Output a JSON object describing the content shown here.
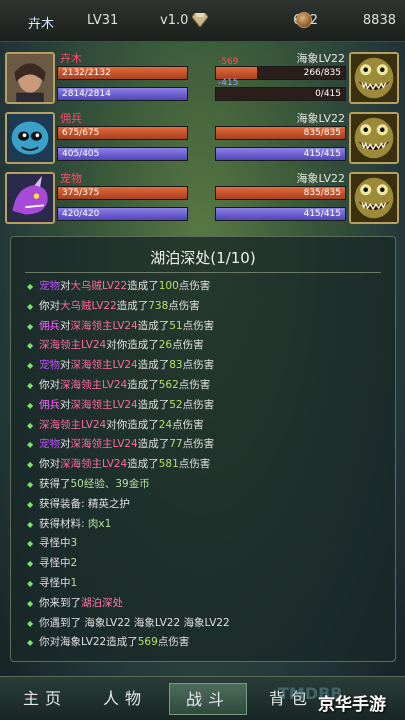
{
  "topbar": {
    "player_name": "卉木",
    "level": "LV31",
    "version": "v1.0",
    "gem_icon": "diamond-icon",
    "money": "622",
    "coin_icon": "coin-icon",
    "gold": "8838"
  },
  "party": [
    {
      "ally": {
        "name": "卉木",
        "hp_text": "2132/2132",
        "hp_frac": 1.0,
        "mp_text": "2814/2814",
        "mp_frac": 1.0,
        "portrait": "hero-portrait"
      },
      "enemy": {
        "name": "海象LV22",
        "hp_text": "266/835",
        "hp_frac": 0.32,
        "mp_text": "0/415",
        "mp_frac": 0.0,
        "dmg_hp": "-569",
        "dmg_mp": "-415",
        "portrait": "walrus-monster-portrait"
      }
    },
    {
      "ally": {
        "name": "佣兵",
        "hp_text": "675/675",
        "hp_frac": 1.0,
        "mp_text": "405/405",
        "mp_frac": 1.0,
        "portrait": "mercenary-portrait"
      },
      "enemy": {
        "name": "海象LV22",
        "hp_text": "835/835",
        "hp_frac": 1.0,
        "mp_text": "415/415",
        "mp_frac": 1.0,
        "portrait": "walrus-monster-portrait"
      }
    },
    {
      "ally": {
        "name": "宠物",
        "hp_text": "375/375",
        "hp_frac": 1.0,
        "mp_text": "420/420",
        "mp_frac": 1.0,
        "portrait": "pet-dragon-portrait"
      },
      "enemy": {
        "name": "海象LV22",
        "hp_text": "835/835",
        "hp_frac": 1.0,
        "mp_text": "415/415",
        "mp_frac": 1.0,
        "portrait": "walrus-monster-portrait"
      }
    }
  ],
  "panel": {
    "title": "湖泊深处(1/10)",
    "log": [
      [
        [
          "pet",
          "宠物"
        ],
        [
          "txt",
          "对"
        ],
        [
          "foe",
          "大乌贼LV22"
        ],
        [
          "txt",
          "造成了"
        ],
        [
          "num",
          "100"
        ],
        [
          "txt",
          "点伤害"
        ]
      ],
      [
        [
          "you",
          "你"
        ],
        [
          "txt",
          "对"
        ],
        [
          "foe",
          "大乌贼LV22"
        ],
        [
          "txt",
          "造成了"
        ],
        [
          "num",
          "738"
        ],
        [
          "txt",
          "点伤害"
        ]
      ],
      [
        [
          "merc",
          "佣兵"
        ],
        [
          "txt",
          "对"
        ],
        [
          "foe",
          "深海领主LV24"
        ],
        [
          "txt",
          "造成了"
        ],
        [
          "num",
          "51"
        ],
        [
          "txt",
          "点伤害"
        ]
      ],
      [
        [
          "foe",
          "深海领主LV24"
        ],
        [
          "txt",
          "对"
        ],
        [
          "you",
          "你"
        ],
        [
          "txt",
          "造成了"
        ],
        [
          "num",
          "26"
        ],
        [
          "txt",
          "点伤害"
        ]
      ],
      [
        [
          "pet",
          "宠物"
        ],
        [
          "txt",
          "对"
        ],
        [
          "foe",
          "深海领主LV24"
        ],
        [
          "txt",
          "造成了"
        ],
        [
          "num",
          "83"
        ],
        [
          "txt",
          "点伤害"
        ]
      ],
      [
        [
          "you",
          "你"
        ],
        [
          "txt",
          "对"
        ],
        [
          "foe",
          "深海领主LV24"
        ],
        [
          "txt",
          "造成了"
        ],
        [
          "num",
          "562"
        ],
        [
          "txt",
          "点伤害"
        ]
      ],
      [
        [
          "merc",
          "佣兵"
        ],
        [
          "txt",
          "对"
        ],
        [
          "foe",
          "深海领主LV24"
        ],
        [
          "txt",
          "造成了"
        ],
        [
          "num",
          "52"
        ],
        [
          "txt",
          "点伤害"
        ]
      ],
      [
        [
          "foe",
          "深海领主LV24"
        ],
        [
          "txt",
          "对"
        ],
        [
          "you",
          "你"
        ],
        [
          "txt",
          "造成了"
        ],
        [
          "num",
          "24"
        ],
        [
          "txt",
          "点伤害"
        ]
      ],
      [
        [
          "pet",
          "宠物"
        ],
        [
          "txt",
          "对"
        ],
        [
          "foe",
          "深海领主LV24"
        ],
        [
          "txt",
          "造成了"
        ],
        [
          "num",
          "77"
        ],
        [
          "txt",
          "点伤害"
        ]
      ],
      [
        [
          "you",
          "你"
        ],
        [
          "txt",
          "对"
        ],
        [
          "foe",
          "深海领主LV24"
        ],
        [
          "txt",
          "造成了"
        ],
        [
          "num",
          "581"
        ],
        [
          "txt",
          "点伤害"
        ]
      ],
      [
        [
          "txt",
          "获得了"
        ],
        [
          "gain",
          "50经验、39金币"
        ]
      ],
      [
        [
          "txt",
          "获得装备: 精英之护"
        ]
      ],
      [
        [
          "txt",
          "获得材料: "
        ],
        [
          "gain",
          "肉x1"
        ]
      ],
      [
        [
          "txt",
          "寻怪中"
        ],
        [
          "gain",
          "3"
        ]
      ],
      [
        [
          "txt",
          "寻怪中"
        ],
        [
          "gain",
          "2"
        ]
      ],
      [
        [
          "txt",
          "寻怪中"
        ],
        [
          "gain",
          "1"
        ]
      ],
      [
        [
          "you",
          "你"
        ],
        [
          "txt",
          "来到了"
        ],
        [
          "loc",
          "湖泊深处"
        ]
      ],
      [
        [
          "txt",
          "你遇到了 海象LV22 海象LV22 海象LV22"
        ]
      ],
      [
        [
          "txt",
          "你对海象LV22造成了"
        ],
        [
          "num",
          "569"
        ],
        [
          "txt",
          "点伤害"
        ]
      ]
    ]
  },
  "nav": {
    "tabs": [
      {
        "label": "主页",
        "active": false
      },
      {
        "label": "人物",
        "active": false
      },
      {
        "label": "战斗",
        "active": true
      },
      {
        "label": "背包",
        "active": false
      }
    ]
  },
  "watermark": "TMDBB",
  "brand": "京华手游",
  "colors": {
    "hp_bar": "#d0552c",
    "mp_bar": "#6a5ed0",
    "ally_name": "#ff4b6a",
    "log_number": "#b6e06a",
    "log_bullet": "#7ce06a",
    "portrait_frame": "#b8a060"
  }
}
